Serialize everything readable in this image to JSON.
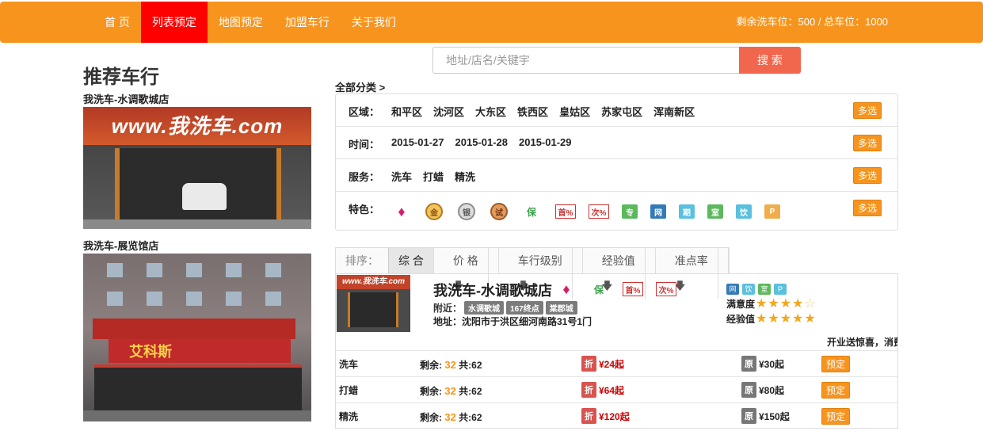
{
  "nav": {
    "items": [
      "首 页",
      "列表预定",
      "地图预定",
      "加盟车行",
      "关于我们"
    ],
    "active_index": 1,
    "stat": "剩余洗车位：500 / 总车位：1000"
  },
  "search": {
    "placeholder": "地址/店名/关键宇",
    "button": "搜 索"
  },
  "recommend": {
    "title": "推荐车行",
    "stores": [
      {
        "name": "我洗车-水调歌城店",
        "sign_text": "www.我洗车.com"
      },
      {
        "name": "我洗车-展览馆店",
        "sign_text": "艾科斯"
      }
    ]
  },
  "filter": {
    "all_label": "全部分类 >",
    "multi_label": "多选",
    "rows": [
      {
        "label": "区域：",
        "options": [
          "和平区",
          "沈河区",
          "大东区",
          "铁西区",
          "皇姑区",
          "苏家屯区",
          "浑南新区"
        ]
      },
      {
        "label": "时间：",
        "options": [
          "2015-01-27",
          "2015-01-28",
          "2015-01-29"
        ]
      },
      {
        "label": "服务：",
        "options": [
          "洗车",
          "打蜡",
          "精洗"
        ]
      },
      {
        "label": "特色：",
        "options": []
      }
    ],
    "feature_icons": [
      {
        "icon": "diamond-icon",
        "glyph": "♦"
      },
      {
        "icon": "gold-coin-icon",
        "glyph": "金"
      },
      {
        "icon": "silver-coin-icon",
        "glyph": "银"
      },
      {
        "icon": "bronze-coin-icon",
        "glyph": "试"
      },
      {
        "icon": "guarantee-icon",
        "glyph": "保"
      },
      {
        "icon": "first-discount-icon",
        "glyph": "首%"
      },
      {
        "icon": "next-discount-icon",
        "glyph": "次%"
      },
      {
        "icon": "exclusive-icon",
        "glyph": "专",
        "color": "#5cb85c"
      },
      {
        "icon": "wifi-icon",
        "glyph": "网",
        "color": "#337ab7"
      },
      {
        "icon": "period-icon",
        "glyph": "期",
        "color": "#5bc0de"
      },
      {
        "icon": "indoor-icon",
        "glyph": "室",
        "color": "#5cb85c"
      },
      {
        "icon": "drink-icon",
        "glyph": "饮",
        "color": "#5bc0de"
      },
      {
        "icon": "parking-icon",
        "glyph": "P",
        "color": "#f0ad4e"
      }
    ]
  },
  "sort": {
    "label": "排序：",
    "options": [
      "综 合",
      "价 格",
      "车行级别",
      "经验值",
      "准点率"
    ],
    "arrow": "🡇"
  },
  "listing": {
    "name": "我洗车-水调歌城店",
    "nearby_label": "附近：",
    "nearby_tags": [
      "水调歌城",
      "167终点",
      "棠郡城"
    ],
    "address": "地址：沈阳市于洪区细河南路31号1门",
    "feature_tags": [
      {
        "glyph": "网",
        "color": "#337ab7"
      },
      {
        "glyph": "饮",
        "color": "#5bc0de"
      },
      {
        "glyph": "室",
        "color": "#5cb85c"
      },
      {
        "glyph": "P",
        "color": "#5bc0de"
      }
    ],
    "satisfaction_label": "满意度",
    "satisfaction_stars": 4,
    "experience_label": "经验值",
    "experience_stars": 5,
    "promo": "开业送惊喜，消费",
    "services": [
      {
        "name": "洗车",
        "remain_label": "剩余:",
        "remain": "32",
        "total": "共:62",
        "disc_label": "折",
        "price": "¥24起",
        "orig_label": "原",
        "orig_price": "¥30起",
        "book": "预定"
      },
      {
        "name": "打蜡",
        "remain_label": "剩余:",
        "remain": "32",
        "total": "共:62",
        "disc_label": "折",
        "price": "¥64起",
        "orig_label": "原",
        "orig_price": "¥80起",
        "book": "预定"
      },
      {
        "name": "精洗",
        "remain_label": "剩余:",
        "remain": "32",
        "total": "共:62",
        "disc_label": "折",
        "price": "¥120起",
        "orig_label": "原",
        "orig_price": "¥150起",
        "book": "预定"
      }
    ]
  }
}
